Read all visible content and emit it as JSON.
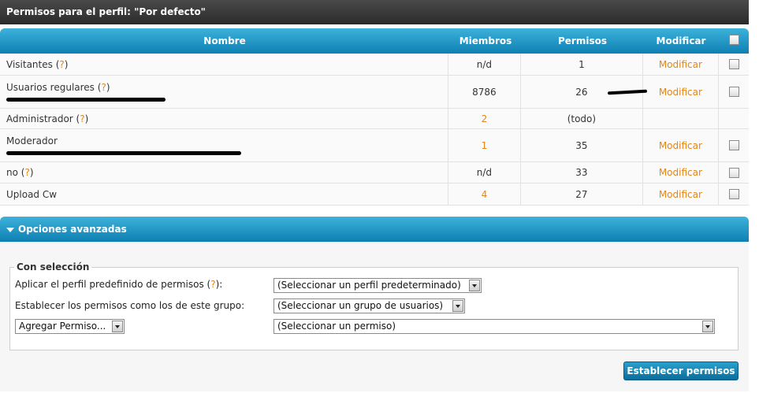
{
  "header": {
    "title": "Permisos para el perfil: \"Por defecto\""
  },
  "table": {
    "columns": [
      "Nombre",
      "Miembros",
      "Permisos",
      "Modificar"
    ],
    "rows": [
      {
        "name": "Visitantes",
        "help": "?",
        "members": "n/d",
        "perms": "1",
        "modify": "Modificar"
      },
      {
        "name": "Usuarios regulares",
        "help": "?",
        "members": "8786",
        "perms": "26",
        "modify": "Modificar"
      },
      {
        "name": "Administrador",
        "help": "?",
        "members": "2",
        "perms": "(todo)",
        "modify": ""
      },
      {
        "name": "Moderador",
        "help": "",
        "members": "1",
        "perms": "35",
        "modify": "Modificar"
      },
      {
        "name": "no",
        "help": "?",
        "members": "n/d",
        "perms": "33",
        "modify": "Modificar"
      },
      {
        "name": "Upload Cw",
        "help": "",
        "members": "4",
        "perms": "27",
        "modify": "Modificar"
      }
    ]
  },
  "advanced": {
    "title": "Opciones avanzadas"
  },
  "selection": {
    "legend": "Con selección",
    "apply_label": "Aplicar el perfil predefinido de permisos",
    "apply_help": "?",
    "apply_select": "(Seleccionar un perfil predeterminado)",
    "set_label": "Establecer los permisos como los de este grupo:",
    "set_select": "(Seleccionar un grupo de usuarios)",
    "add_select": "Agregar Permiso...",
    "perm_select": "(Seleccionar un permiso)"
  },
  "submit_label": "Establecer permisos",
  "colors": {
    "accent": "#0e7fb3",
    "link": "#e0861a"
  }
}
